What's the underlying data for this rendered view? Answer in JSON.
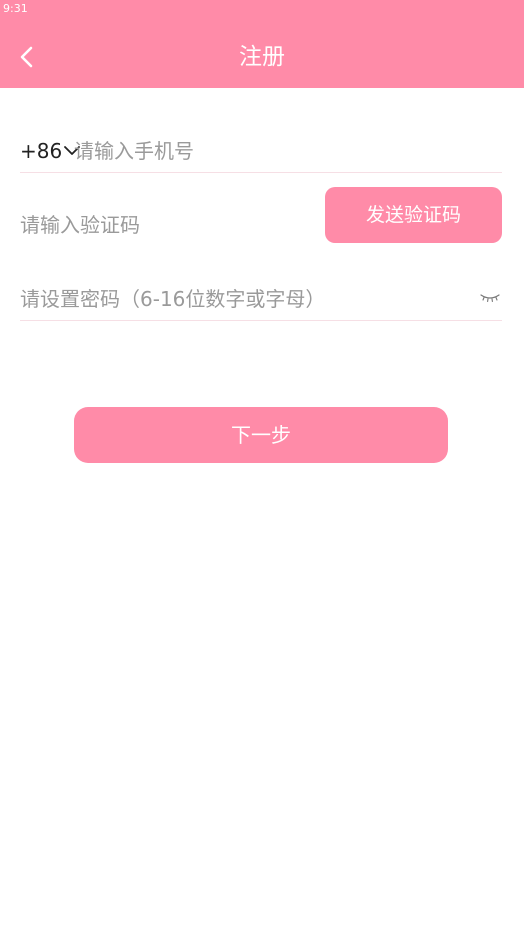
{
  "status_bar": {
    "time": "9:31"
  },
  "header": {
    "title": "注册",
    "back_icon": "chevron-left-icon"
  },
  "phone": {
    "country_code": "+86",
    "dropdown_icon": "chevron-down-icon",
    "placeholder": "请输入手机号",
    "value": ""
  },
  "verification": {
    "placeholder": "请输入验证码",
    "value": "",
    "send_label": "发送验证码"
  },
  "password": {
    "placeholder": "请设置密码（6-16位数字或字母）",
    "value": "",
    "toggle_icon": "eye-closed-icon"
  },
  "next_button": {
    "label": "下一步"
  },
  "colors": {
    "accent": "#ff8ba8",
    "divider": "#f6dfe5",
    "placeholder": "#9a9a9a"
  }
}
